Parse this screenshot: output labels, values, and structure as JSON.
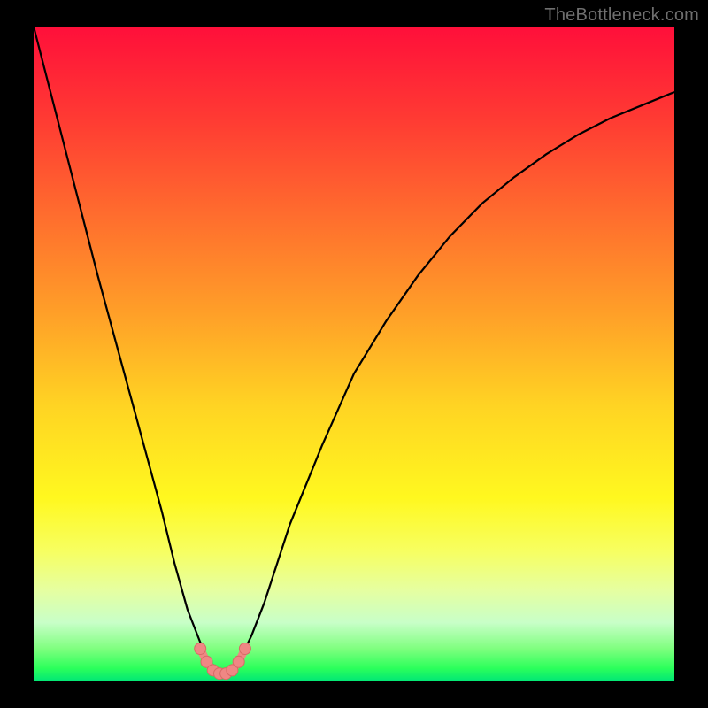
{
  "watermark": "TheBottleneck.com",
  "colors": {
    "curve": "#000000",
    "marker_fill": "#ef8784",
    "marker_stroke": "#d86a66",
    "background_black": "#000000"
  },
  "chart_data": {
    "type": "line",
    "title": "",
    "xlabel": "",
    "ylabel": "",
    "xlim": [
      0,
      100
    ],
    "ylim": [
      0,
      100
    ],
    "grid": false,
    "legend": false,
    "series": [
      {
        "name": "bottleneck-curve",
        "x": [
          0,
          5,
          10,
          15,
          20,
          22,
          24,
          26,
          27.5,
          29,
          30,
          31,
          32,
          34,
          36,
          40,
          45,
          50,
          55,
          60,
          65,
          70,
          75,
          80,
          85,
          90,
          95,
          100
        ],
        "y": [
          100,
          81,
          62,
          44,
          26,
          18,
          11,
          6,
          3,
          1.5,
          1,
          1.5,
          3,
          7,
          12,
          24,
          36,
          47,
          55,
          62,
          68,
          73,
          77,
          80.5,
          83.5,
          86,
          88,
          90
        ]
      }
    ],
    "markers": {
      "name": "optimal-range",
      "x": [
        26.0,
        27.0,
        28.0,
        29.0,
        30.0,
        31.0,
        32.0,
        33.0
      ],
      "y": [
        5.0,
        3.0,
        1.7,
        1.2,
        1.2,
        1.7,
        3.0,
        5.0
      ]
    },
    "gradient_stops": [
      {
        "pos": 0.0,
        "color": "#ff0f3a"
      },
      {
        "pos": 0.14,
        "color": "#ff3a33"
      },
      {
        "pos": 0.28,
        "color": "#ff6a2e"
      },
      {
        "pos": 0.44,
        "color": "#ffa028"
      },
      {
        "pos": 0.58,
        "color": "#ffd423"
      },
      {
        "pos": 0.72,
        "color": "#fff81f"
      },
      {
        "pos": 0.8,
        "color": "#f7ff60"
      },
      {
        "pos": 0.86,
        "color": "#e6ffa0"
      },
      {
        "pos": 0.91,
        "color": "#c8ffc8"
      },
      {
        "pos": 0.95,
        "color": "#7fff7f"
      },
      {
        "pos": 0.98,
        "color": "#2bff5b"
      },
      {
        "pos": 1.0,
        "color": "#00e676"
      }
    ]
  }
}
